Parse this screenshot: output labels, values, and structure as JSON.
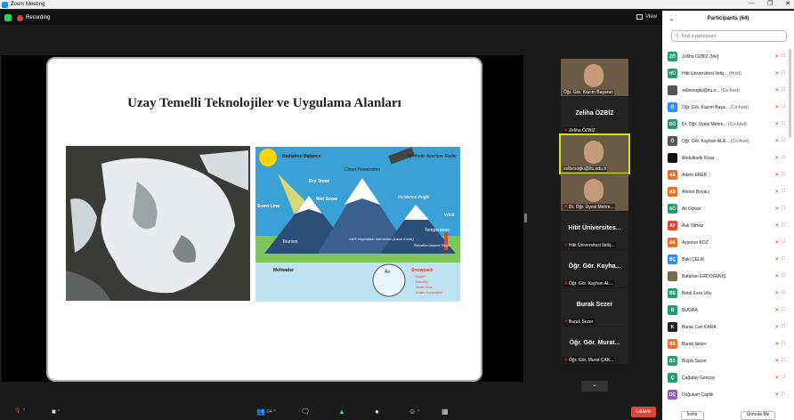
{
  "window": {
    "title": "Zoom Meeting"
  },
  "meeting": {
    "recording_label": "Recording",
    "view_label": "View"
  },
  "slide": {
    "title": "Uzay Temelli Teknolojiler ve Uygulama Alanları",
    "diagram_labels": {
      "radiation": "Radiation Balance",
      "sar": "Synthetic Aperture Radar",
      "cloud": "Cloud Penetration",
      "dry": "Dry Snow",
      "wet": "Wet Snow",
      "incidence": "Incidence Angle",
      "snowline": "Snow Line",
      "wind": "Wind",
      "temp": "Temperature",
      "tourism": "Tourism",
      "sarveg": "SAR-Vegetation Interaction (Land Cover)",
      "elev": "Elevation Aspect Slope",
      "melt": "Meltwater",
      "air": "Air",
      "snowpack": "Snowpack",
      "depth": "Depth",
      "density": "Density",
      "grain": "Grain Size",
      "swe": "Water Equivalent"
    }
  },
  "video_strip": [
    {
      "type": "video",
      "name": "Öğr. Gör. Kazım Başaran",
      "muted": false
    },
    {
      "type": "name",
      "big": "Zeliha ÖZBİZ",
      "name": "Zeliha ÖZBİZ",
      "muted": true
    },
    {
      "type": "video",
      "name": "selbesoglu@itu.edu.tr",
      "muted": false,
      "active": true
    },
    {
      "type": "video",
      "name": "Dr. Öğr. Üyesi Mehm...",
      "muted": true
    },
    {
      "type": "name",
      "big": "Hitit Üniversites...",
      "name": "Hitit Üniversitesi İletiş...",
      "muted": true
    },
    {
      "type": "name",
      "big": "Öğr. Gör. Kayha...",
      "name": "Öğr. Gör. Kayhan AL...",
      "muted": true
    },
    {
      "type": "name",
      "big": "Burak Sezer",
      "name": "Burak Sezer",
      "muted": true
    },
    {
      "type": "name",
      "big": "Öğr. Gör. Murat...",
      "name": "Öğr. Gör. Murat ÇAK...",
      "muted": true
    }
  ],
  "toolbar": {
    "participants_count": "64",
    "leave_label": "Leave"
  },
  "panel": {
    "title": "Participants (64)",
    "search_placeholder": "Find a participant",
    "invite_label": "Invite",
    "unmute_label": "Unmute Me",
    "participants": [
      {
        "initials": "ZÖ",
        "color": "#22a06b",
        "name": "Zeliha ÖZBİZ (Me)",
        "role": ""
      },
      {
        "initials": "HÜ",
        "color": "#22a06b",
        "name": "Hitit Üniversitesi İletiş...",
        "role": "(Host)"
      },
      {
        "initials": "",
        "color": "#555555",
        "name": "selbesoglu@itu.e...",
        "role": "(Co-host)"
      },
      {
        "initials": "Ö",
        "color": "#2d8cff",
        "name": "Öğr. Gör. Kazım Başa...",
        "role": "(Co-host)"
      },
      {
        "initials": "DÖ",
        "color": "#22a06b",
        "name": "Dr. Öğr. Üyesi Mehm...",
        "role": "(Co-host)"
      },
      {
        "initials": "Ö",
        "color": "#555555",
        "name": "Öğr. Gör. Kayhan ALA...",
        "role": "(Co-host)"
      },
      {
        "initials": "",
        "color": "#111111",
        "name": "Abdulkadir Kiraz",
        "role": ""
      },
      {
        "initials": "AE",
        "color": "#f26d21",
        "name": "Adem EKER",
        "role": ""
      },
      {
        "initials": "AB",
        "color": "#f26d21",
        "name": "Ahmet Boyacı",
        "role": ""
      },
      {
        "initials": "AÖ",
        "color": "#22a06b",
        "name": "Ali Özkan",
        "role": ""
      },
      {
        "initials": "AY",
        "color": "#e0443b",
        "name": "Ask Yilmaz",
        "role": ""
      },
      {
        "initials": "AK",
        "color": "#f26d21",
        "name": "Ayşenur KÖZ",
        "role": ""
      },
      {
        "initials": "BÇ",
        "color": "#2d8cff",
        "name": "Baki ÇELİK",
        "role": ""
      },
      {
        "initials": "",
        "color": "#7a6a4a",
        "name": "Batuhan ERDOĞMUŞ",
        "role": ""
      },
      {
        "initials": "BE",
        "color": "#22a06b",
        "name": "Betül Esra Utlu",
        "role": ""
      },
      {
        "initials": "B",
        "color": "#22a06b",
        "name": "BUĞRA",
        "role": ""
      },
      {
        "initials": "K",
        "color": "#222222",
        "name": "Burak Can KARA",
        "role": ""
      },
      {
        "initials": "BS",
        "color": "#f26d21",
        "name": "Burak Sezer",
        "role": ""
      },
      {
        "initials": "BS",
        "color": "#22a06b",
        "name": "Büşra Sayar",
        "role": ""
      },
      {
        "initials": "Ç",
        "color": "#22a06b",
        "name": "Çağatay Gençay",
        "role": ""
      },
      {
        "initials": "DÇ",
        "color": "#9b59b6",
        "name": "Doğukan Çaplin",
        "role": ""
      }
    ]
  }
}
